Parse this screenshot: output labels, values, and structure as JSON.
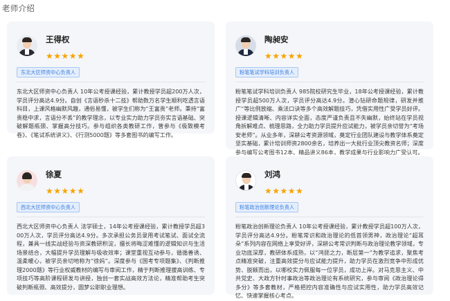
{
  "page": {
    "title": "老师介绍"
  },
  "teachers": [
    {
      "name": "王得权",
      "badge": "东北大区师资中心负责人",
      "rating": 5,
      "bio": "东北大区师资中心负责人 10年公考授课经验，累计教授学员超200万人次，学员评分高达4.9分。自创《言语秒杀十二技》帮助数万名学生顺利吃透言语科目，上课风格幽默风趣，通俗易懂，被学生们称为“王富贵”老师。秉持“富贵稳中求，言语分不丢”的教学理念，以专业实力助力学员夯实言语基础、突破解题瓶颈、掌握高分技巧。参与组织各类教研工作，曾参与《极致模考卷》、《笔试系统讲义》、《行测5000题》等多套图书的编写工作。"
    },
    {
      "name": "陶昶安",
      "badge": "粉笔笔试学科培训负责人",
      "rating": 5,
      "bio": "粉笔笔试学科培训负责人 985院校研究生毕业，18年公考授课经验，累计教授学员超500万人次，学员评分高达4.9分。潜心钻研命题规律，研发并推广“等比例放缩、乘法口诀等多个高效解题技巧，凭借实用性广受学员好评。授课逻辑清晰、内容详实全面，态度严谨负责且不失幽默，始终站在学员视角拆解难点、梳理思路，全力助力学员提升应试能力，被学员亲切誉为“考场安老师”。从业多年，深耕公考资源领域，奠定行业团队建设与教学体系奠定坚实基础，累计培训师资2800余名，培养出一大批行业顶尖教资名师；深度参与编写公考图书12本、精品讲义86本，教学成果与行业影响力广受认可。"
    },
    {
      "name": "徐夏",
      "badge": "西北大区师资中心负责人",
      "rating": 5,
      "bio": "西北大区师资中心负责人 法学硕士，14年公考授课经验，累计教授学员超300万人次，学员评分高达4.9分。多次承担公务员录用考试笔试、面试全流程，兼具一线实战经验与资深教研积淀，擅长将晦涩难懂的逻辑知识与生活场景结合，大幅提升学员理解与吸收效率；课堂重视互动参与，循循善诱、温柔暖心，被学员亲切地称为“徐妈”。深度参与《国考专项题集》、《判断推理2000题》等行业权威教材的编写与审阅工作，精于判断推理拔高训练、专项技巧等高阶课程研发与讲授，独创一套实战高效方法论，精准帮助考生突破判断瓶颈、高效提分，圆梦公职职业理想。"
    },
    {
      "name": "刘鸿",
      "badge": "粉笔政治创新理论负责人",
      "rating": 5,
      "bio": "粉笔政治创新理论负责人 10年公考授课经验，累计教授学员超100万人次，学员评分高达4.9分。粉笔常识和政治理论的低首领男神，政治理论“超耳朵”系列内容在网络上享受好评，深耕公考常识判断与政治理论教学领域，专业功底深厚，教研体系成熟，以“鸿琵之力，断层第一”为教学追求，聚焦考点精准突破，注重高效提分与应试能力提升，助力学员在激烈竞争中形成优势、脱颖而出，以哪校实力佩服每一位学员，成功上岸。对马克思主义、中共党史、大政方针时事政治等政治理论有系统研究，参与审阅《政治理论得多分》等多套教材，严格把控内容准确性与应试实用性，助力学员高效记忆、快速掌握核心考点。"
    }
  ]
}
